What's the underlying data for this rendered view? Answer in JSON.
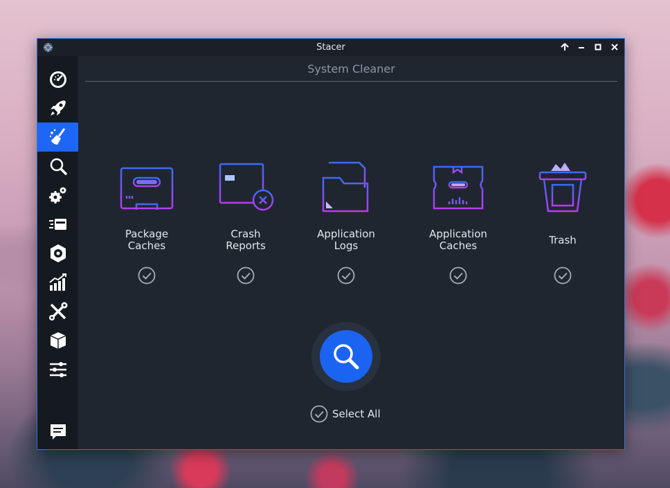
{
  "window": {
    "title": "Stacer"
  },
  "page": {
    "title": "System Cleaner"
  },
  "sidebar": {
    "items": [
      {
        "name": "dashboard",
        "icon": "speedometer-icon",
        "active": false
      },
      {
        "name": "startup-apps",
        "icon": "rocket-icon",
        "active": false
      },
      {
        "name": "system-cleaner",
        "icon": "broom-icon",
        "active": true
      },
      {
        "name": "search",
        "icon": "magnifier-icon",
        "active": false
      },
      {
        "name": "services",
        "icon": "gears-icon",
        "active": false
      },
      {
        "name": "processes",
        "icon": "processes-icon",
        "active": false
      },
      {
        "name": "uninstaller",
        "icon": "disk-icon",
        "active": false
      },
      {
        "name": "resources",
        "icon": "bar-chart-icon",
        "active": false
      },
      {
        "name": "helpers",
        "icon": "tools-icon",
        "active": false
      },
      {
        "name": "apt-repository",
        "icon": "box-icon",
        "active": false
      },
      {
        "name": "settings",
        "icon": "sliders-icon",
        "active": false
      },
      {
        "name": "feedback",
        "icon": "chat-icon",
        "active": false
      }
    ]
  },
  "categories": [
    {
      "line1": "Package",
      "line2": "Caches",
      "icon": "package-cache-icon",
      "checked": true
    },
    {
      "line1": "Crash",
      "line2": "Reports",
      "icon": "crash-report-icon",
      "checked": true
    },
    {
      "line1": "Application",
      "line2": "Logs",
      "icon": "application-logs-icon",
      "checked": true
    },
    {
      "line1": "Application",
      "line2": "Caches",
      "icon": "application-cache-icon",
      "checked": true
    },
    {
      "line1": "Trash",
      "line2": "",
      "icon": "trash-basket-icon",
      "checked": true
    }
  ],
  "scan": {
    "icon": "search-icon"
  },
  "select_all": {
    "label": "Select All",
    "checked": true
  },
  "colors": {
    "accent": "#1e66f5",
    "icon_gradient_start": "#3a6cf4",
    "icon_gradient_end": "#b53df0",
    "window_bg": "#1f2630",
    "sidebar_bg": "#151a21"
  }
}
